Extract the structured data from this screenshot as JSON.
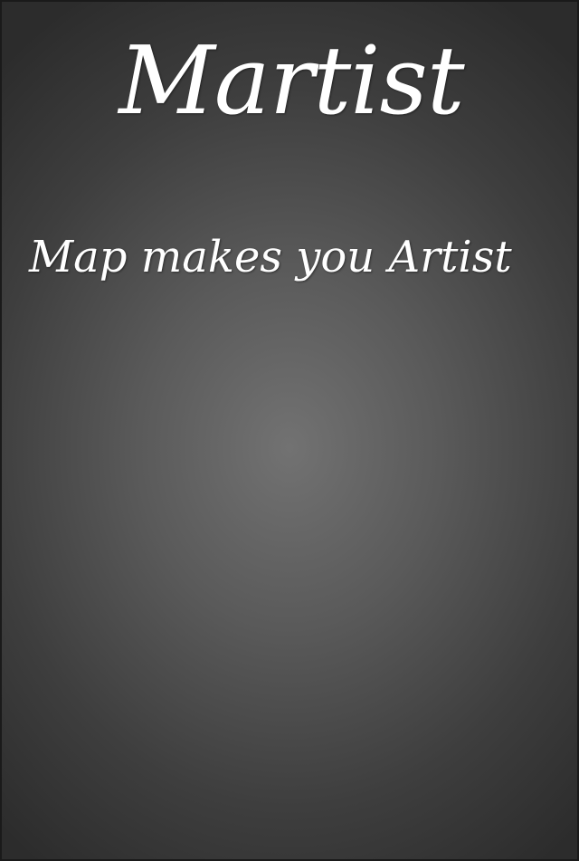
{
  "app": {
    "title": "Martist",
    "tagline": "Map makes you Artist"
  },
  "colors": {
    "text": "#ffffff",
    "background_center": "#727272",
    "background_edge": "#2c2c2c"
  }
}
